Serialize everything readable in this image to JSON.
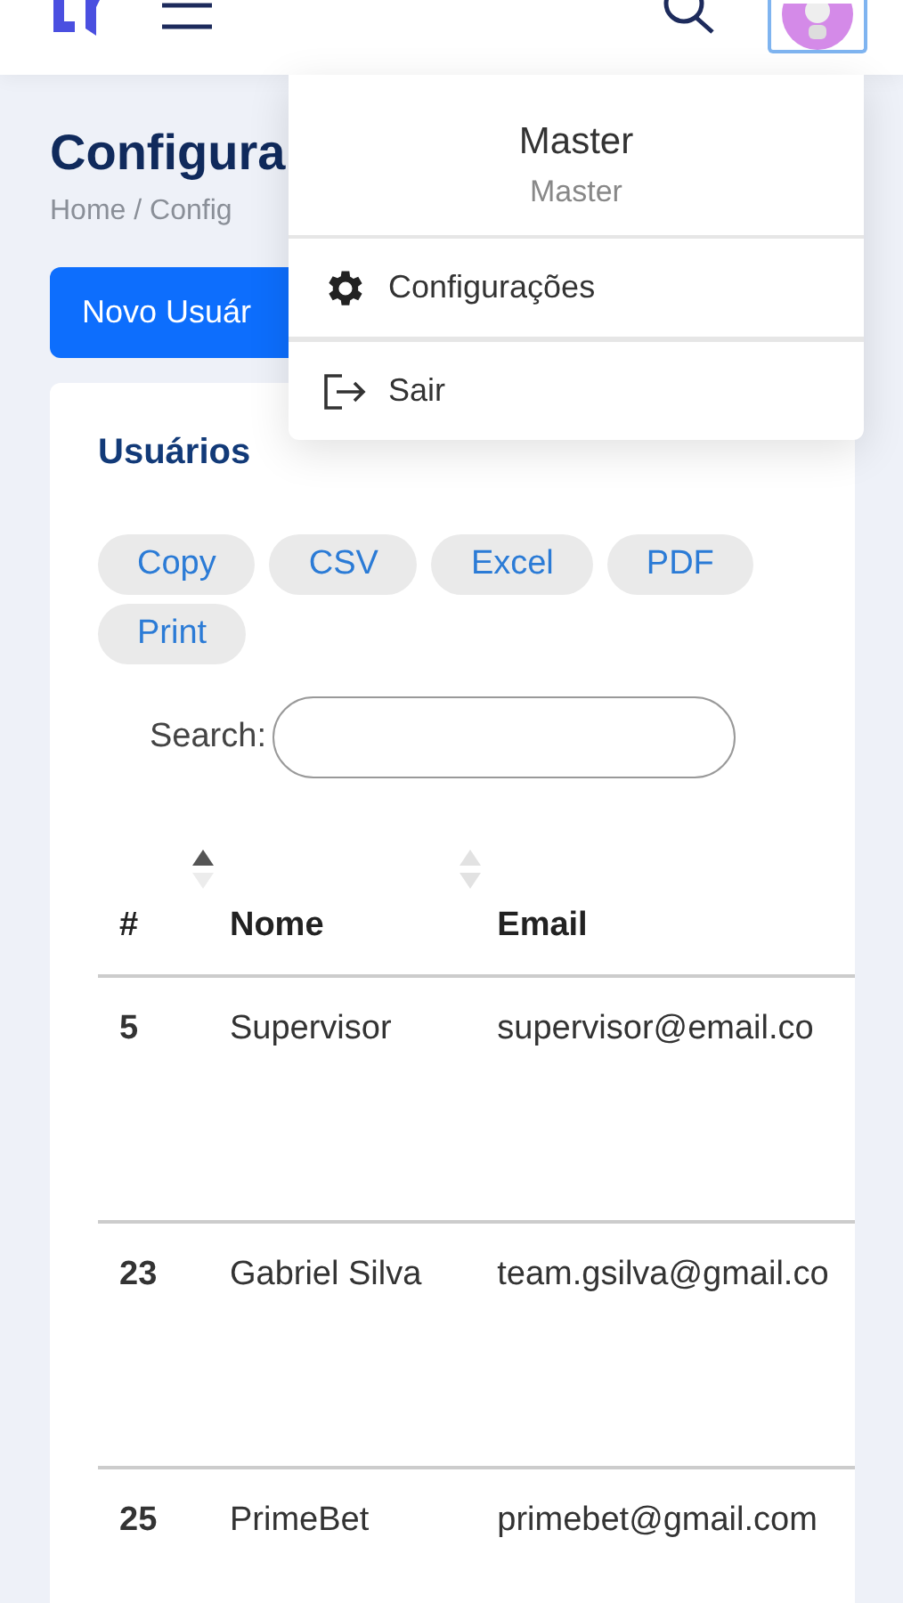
{
  "page": {
    "title": "Configura",
    "breadcrumb": "Home / Config",
    "new_button": "Novo Usuár"
  },
  "user_menu": {
    "name": "Master",
    "role": "Master",
    "items": [
      {
        "kind": "settings",
        "label": "Configurações"
      },
      {
        "kind": "logout",
        "label": "Sair"
      }
    ]
  },
  "card": {
    "title": "Usuários",
    "export_buttons": [
      "Copy",
      "CSV",
      "Excel",
      "PDF",
      "Print"
    ],
    "search_label": "Search:"
  },
  "table": {
    "columns": [
      {
        "label": "#",
        "sortable": true,
        "sorted": true
      },
      {
        "label": "Nome",
        "sortable": true,
        "sorted": false
      },
      {
        "label": "Email",
        "sortable": false
      }
    ],
    "rows": [
      [
        "5",
        "Supervisor",
        "supervisor@email.co"
      ],
      [
        "23",
        "Gabriel Silva",
        "team.gsilva@gmail.co"
      ],
      [
        "25",
        "PrimeBet",
        "primebet@gmail.com"
      ]
    ]
  }
}
